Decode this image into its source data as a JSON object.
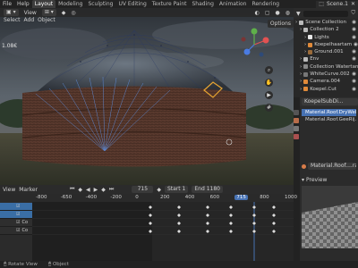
{
  "topbar": {
    "menus": [
      "File",
      "Help"
    ],
    "tabs": [
      "Layout",
      "Modeling",
      "Sculpting",
      "UV Editing",
      "Texture Paint",
      "Shading",
      "Animation",
      "Rendering"
    ],
    "active_tab": "Layout",
    "scene": "Scene.1"
  },
  "viewport": {
    "header": {
      "select": "Select",
      "add": "Add",
      "object": "Object",
      "view": "View"
    },
    "options": "Options",
    "fps": "1.08€"
  },
  "outliner": {
    "rows": [
      {
        "label": "Scene Collection",
        "icon": "collection-icon",
        "color": "#bbbbbb",
        "indent": 0,
        "selected": false
      },
      {
        "label": "Collection 2",
        "icon": "collection-icon",
        "color": "#bbbbbb",
        "indent": 1,
        "selected": false
      },
      {
        "label": "Lights",
        "icon": "light-icon",
        "color": "#e8e8e8",
        "indent": 2,
        "selected": false
      },
      {
        "label": "Koepelhaartam",
        "icon": "object-icon",
        "color": "#e08a3a",
        "indent": 2,
        "selected": false
      },
      {
        "label": "Ground.001",
        "icon": "object-icon",
        "color": "#9a6b3a",
        "indent": 2,
        "selected": false
      },
      {
        "label": "Env",
        "icon": "collection-icon",
        "color": "#bbbbbb",
        "indent": 1,
        "selected": false
      },
      {
        "label": "Collection Watertanken",
        "icon": "collection-icon",
        "color": "#888888",
        "indent": 1,
        "selected": false
      },
      {
        "label": "WhiteCurve.002",
        "icon": "curve-icon",
        "color": "#777777",
        "indent": 1,
        "selected": false
      },
      {
        "label": "Camera.004",
        "icon": "camera-icon",
        "color": "#e08a3a",
        "indent": 1,
        "selected": false
      },
      {
        "label": "Koepel.Cut",
        "icon": "object-icon",
        "color": "#e08a3a",
        "indent": 1,
        "selected": false
      }
    ]
  },
  "properties": {
    "object_name": "KoepelSubDi...",
    "material_slots": [
      "Material.Roof.DryWell.Lo",
      "Material.Roof.GeeRij.l"
    ],
    "material_name": "Material.Roof....rames",
    "preview_label": "Preview"
  },
  "timeline": {
    "menus": [
      "View",
      "Marker"
    ],
    "current_frame": "715",
    "start_label": "Start",
    "start_value": "1",
    "end_label": "End",
    "end_value": "1180",
    "ruler_ticks": [
      "-800",
      "-650",
      "-400",
      "-200",
      "0",
      "200",
      "400",
      "600",
      "715",
      "800",
      "1000"
    ],
    "channels": [
      {
        "label": "",
        "color": "#3a6ea5"
      },
      {
        "label": "",
        "color": "#3a6ea5"
      },
      {
        "label": "Co",
        "color": "#2e2e2e"
      },
      {
        "label": "Co",
        "color": "#2e2e2e"
      }
    ]
  },
  "statusbar": {
    "rotate": "Rotate View",
    "object": "Object"
  },
  "colors": {
    "accent": "#4772b3",
    "playhead": "#4772b3",
    "selection": "#e8a531"
  }
}
